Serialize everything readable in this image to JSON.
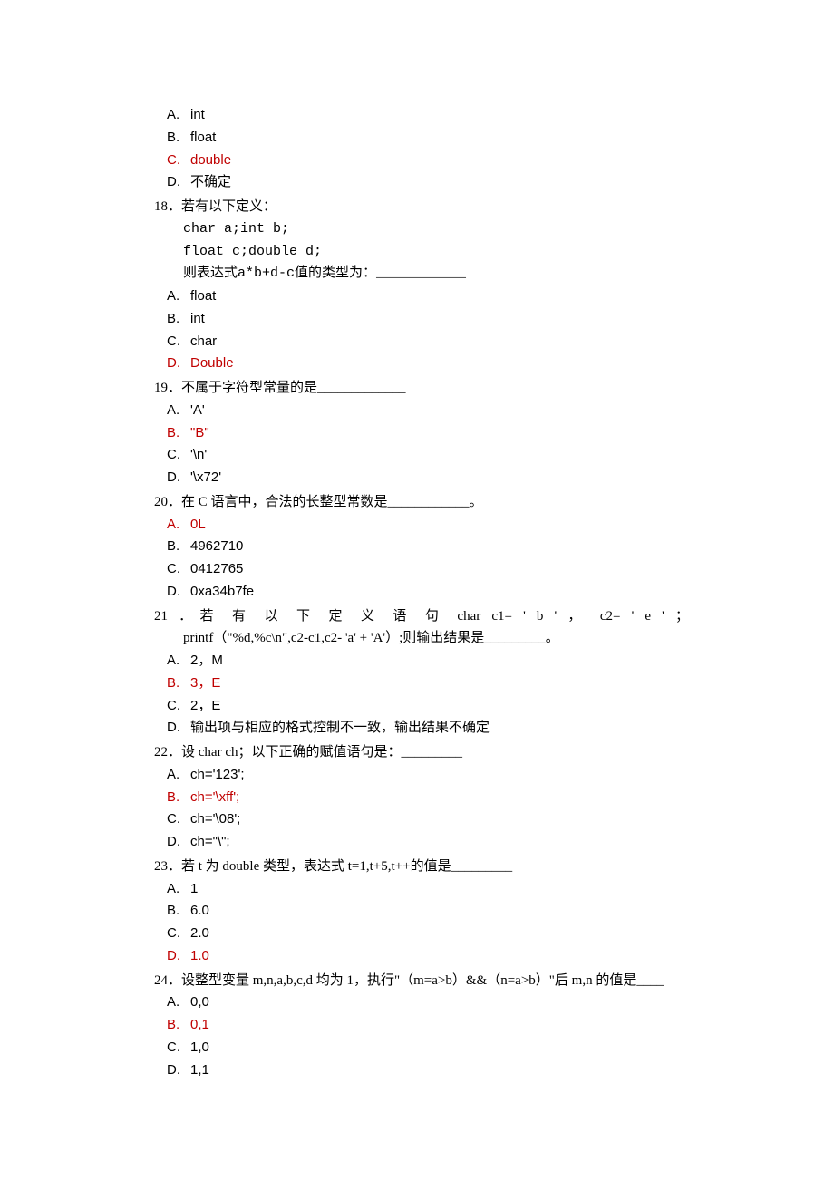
{
  "questions": [
    {
      "id": 17,
      "num": "",
      "prompt": "",
      "code": [],
      "options": [
        {
          "label": "A.",
          "text": "int",
          "highlighted": false,
          "sans": true
        },
        {
          "label": "B.",
          "text": "float",
          "highlighted": false,
          "sans": true
        },
        {
          "label": "C.",
          "text": "double",
          "highlighted": true,
          "sans": true
        },
        {
          "label": "D.",
          "text": "不确定",
          "highlighted": false,
          "cjk": true
        }
      ]
    },
    {
      "id": 18,
      "num": "18．",
      "prompt": "若有以下定义：",
      "code": [
        "char a;int b;",
        "float c;double d;",
        "则表达式a*b+d-c值的类型为：___________"
      ],
      "options": [
        {
          "label": "A.",
          "text": "float",
          "highlighted": false,
          "sans": true
        },
        {
          "label": "B.",
          "text": "int",
          "highlighted": false,
          "sans": true
        },
        {
          "label": "C.",
          "text": "char",
          "highlighted": false,
          "sans": true
        },
        {
          "label": "D.",
          "text": "Double",
          "highlighted": true,
          "sans": true
        }
      ]
    },
    {
      "id": 19,
      "num": "19．",
      "prompt": "不属于字符型常量的是_____________",
      "code": [],
      "options": [
        {
          "label": "A.",
          "text": "'A'",
          "highlighted": false,
          "sans": true
        },
        {
          "label": "B.",
          "text": "\"B\"",
          "highlighted": true,
          "sans": true
        },
        {
          "label": "C.",
          "text": "'\\n'",
          "highlighted": false,
          "sans": true
        },
        {
          "label": "D.",
          "text": "'\\x72'",
          "highlighted": false,
          "sans": true
        }
      ]
    },
    {
      "id": 20,
      "num": "20．",
      "prompt": "在 C 语言中，合法的长整型常数是____________。",
      "code": [],
      "options": [
        {
          "label": "A.",
          "text": "0L",
          "highlighted": true,
          "sans": true
        },
        {
          "label": "B.",
          "text": "4962710",
          "highlighted": false,
          "sans": true
        },
        {
          "label": "C.",
          "text": "0412765",
          "highlighted": false,
          "sans": true
        },
        {
          "label": "D.",
          "text": "0xa34b7fe",
          "highlighted": false,
          "sans": true
        }
      ]
    },
    {
      "id": 21,
      "num": "21 ．",
      "prompt_justify": "若 有 以 下 定 义 语 句  char  c1= ' b ' ，  c2= ' e ' ；",
      "continuation": "printf（\"%d,%c\\n\",c2-c1,c2- 'a' + 'A'）;则输出结果是_________。",
      "code": [],
      "options": [
        {
          "label": "A.",
          "text": "2，M",
          "highlighted": false,
          "sans": true
        },
        {
          "label": "B.",
          "text": "3，E",
          "highlighted": true,
          "sans": true
        },
        {
          "label": "C.",
          "text": "2，E",
          "highlighted": false,
          "sans": true
        },
        {
          "label": "D.",
          "text": "输出项与相应的格式控制不一致，输出结果不确定",
          "highlighted": false,
          "cjk": true
        }
      ]
    },
    {
      "id": 22,
      "num": "22．",
      "prompt": "设 char ch；以下正确的赋值语句是：_________",
      "code": [],
      "options": [
        {
          "label": "A.",
          "text": "ch='123';",
          "highlighted": false,
          "sans": true
        },
        {
          "label": "B.",
          "text": "ch='\\xff';",
          "highlighted": true,
          "sans": true
        },
        {
          "label": "C.",
          "text": "ch='\\08';",
          "highlighted": false,
          "sans": true
        },
        {
          "label": "D.",
          "text": "ch=\"\\\";",
          "highlighted": false,
          "sans": true
        }
      ]
    },
    {
      "id": 23,
      "num": "23．",
      "prompt": "若 t 为 double 类型，表达式 t=1,t+5,t++的值是_________",
      "code": [],
      "options": [
        {
          "label": "A.",
          "text": "1",
          "highlighted": false,
          "sans": true
        },
        {
          "label": "B.",
          "text": "6.0",
          "highlighted": false,
          "sans": true
        },
        {
          "label": "C.",
          "text": "2.0",
          "highlighted": false,
          "sans": true
        },
        {
          "label": "D.",
          "text": "1.0",
          "highlighted": true,
          "sans": true
        }
      ]
    },
    {
      "id": 24,
      "num": "24．",
      "prompt": "设整型变量 m,n,a,b,c,d 均为 1，执行\"（m=a>b）&&（n=a>b）\"后 m,n 的值是____",
      "code": [],
      "options": [
        {
          "label": "A.",
          "text": "0,0",
          "highlighted": false,
          "sans": true
        },
        {
          "label": "B.",
          "text": "0,1",
          "highlighted": true,
          "sans": true
        },
        {
          "label": "C.",
          "text": "1,0",
          "highlighted": false,
          "sans": true
        },
        {
          "label": "D.",
          "text": "1,1",
          "highlighted": false,
          "sans": true
        }
      ]
    }
  ]
}
